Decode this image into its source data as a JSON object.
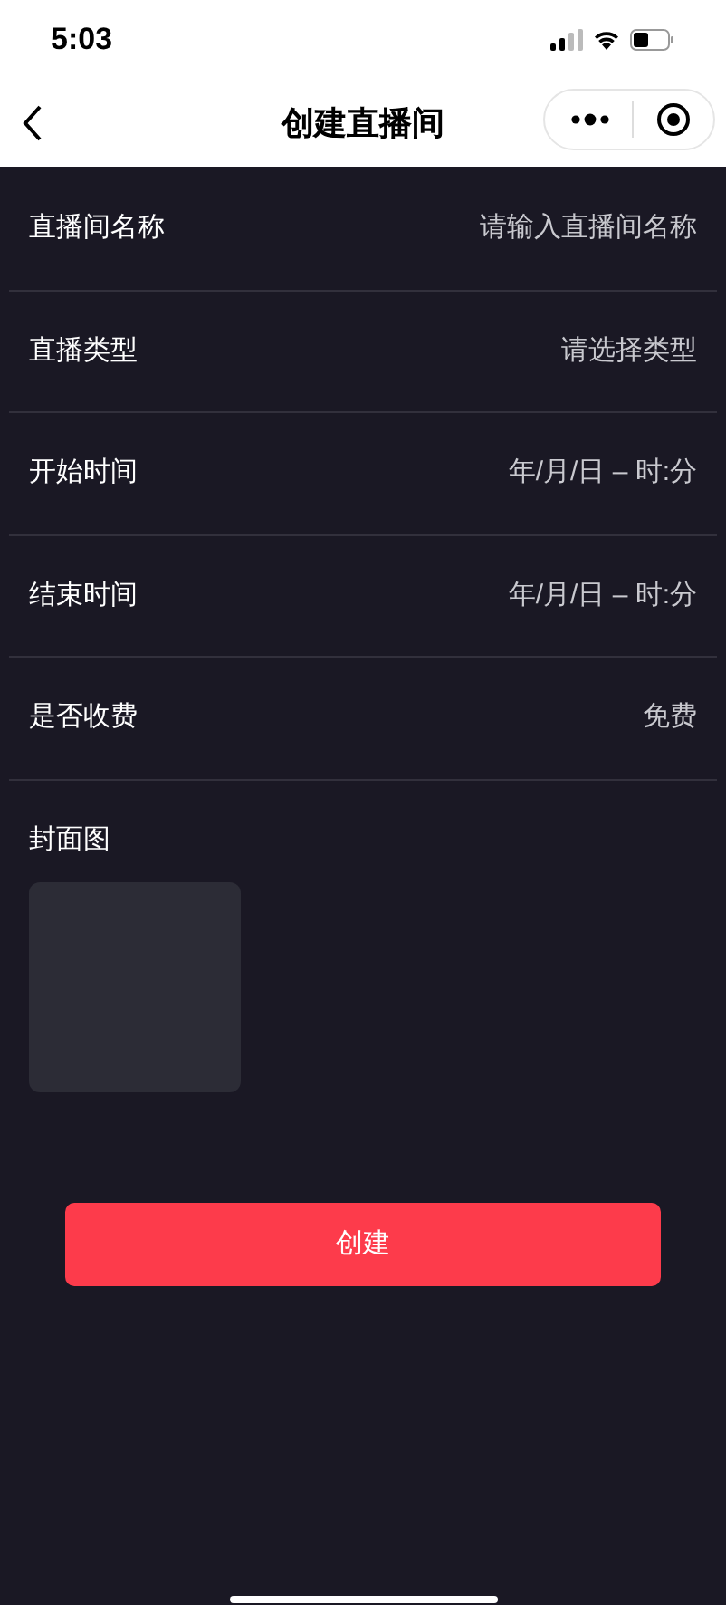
{
  "status_bar": {
    "time": "5:03"
  },
  "nav_bar": {
    "title": "创建直播间"
  },
  "form": {
    "rows": [
      {
        "kind": "input",
        "label": "直播间名称",
        "placeholder": "请输入直播间名称"
      },
      {
        "kind": "picker",
        "label": "直播类型",
        "value": "请选择类型"
      },
      {
        "kind": "picker",
        "label": "开始时间",
        "value": "年/月/日 – 时:分"
      },
      {
        "kind": "picker",
        "label": "结束时间",
        "value": "年/月/日 – 时:分"
      },
      {
        "kind": "picker",
        "label": "是否收费",
        "value": "免费"
      }
    ]
  },
  "cover": {
    "label": "封面图"
  },
  "submit_button": {
    "label": "创建"
  }
}
